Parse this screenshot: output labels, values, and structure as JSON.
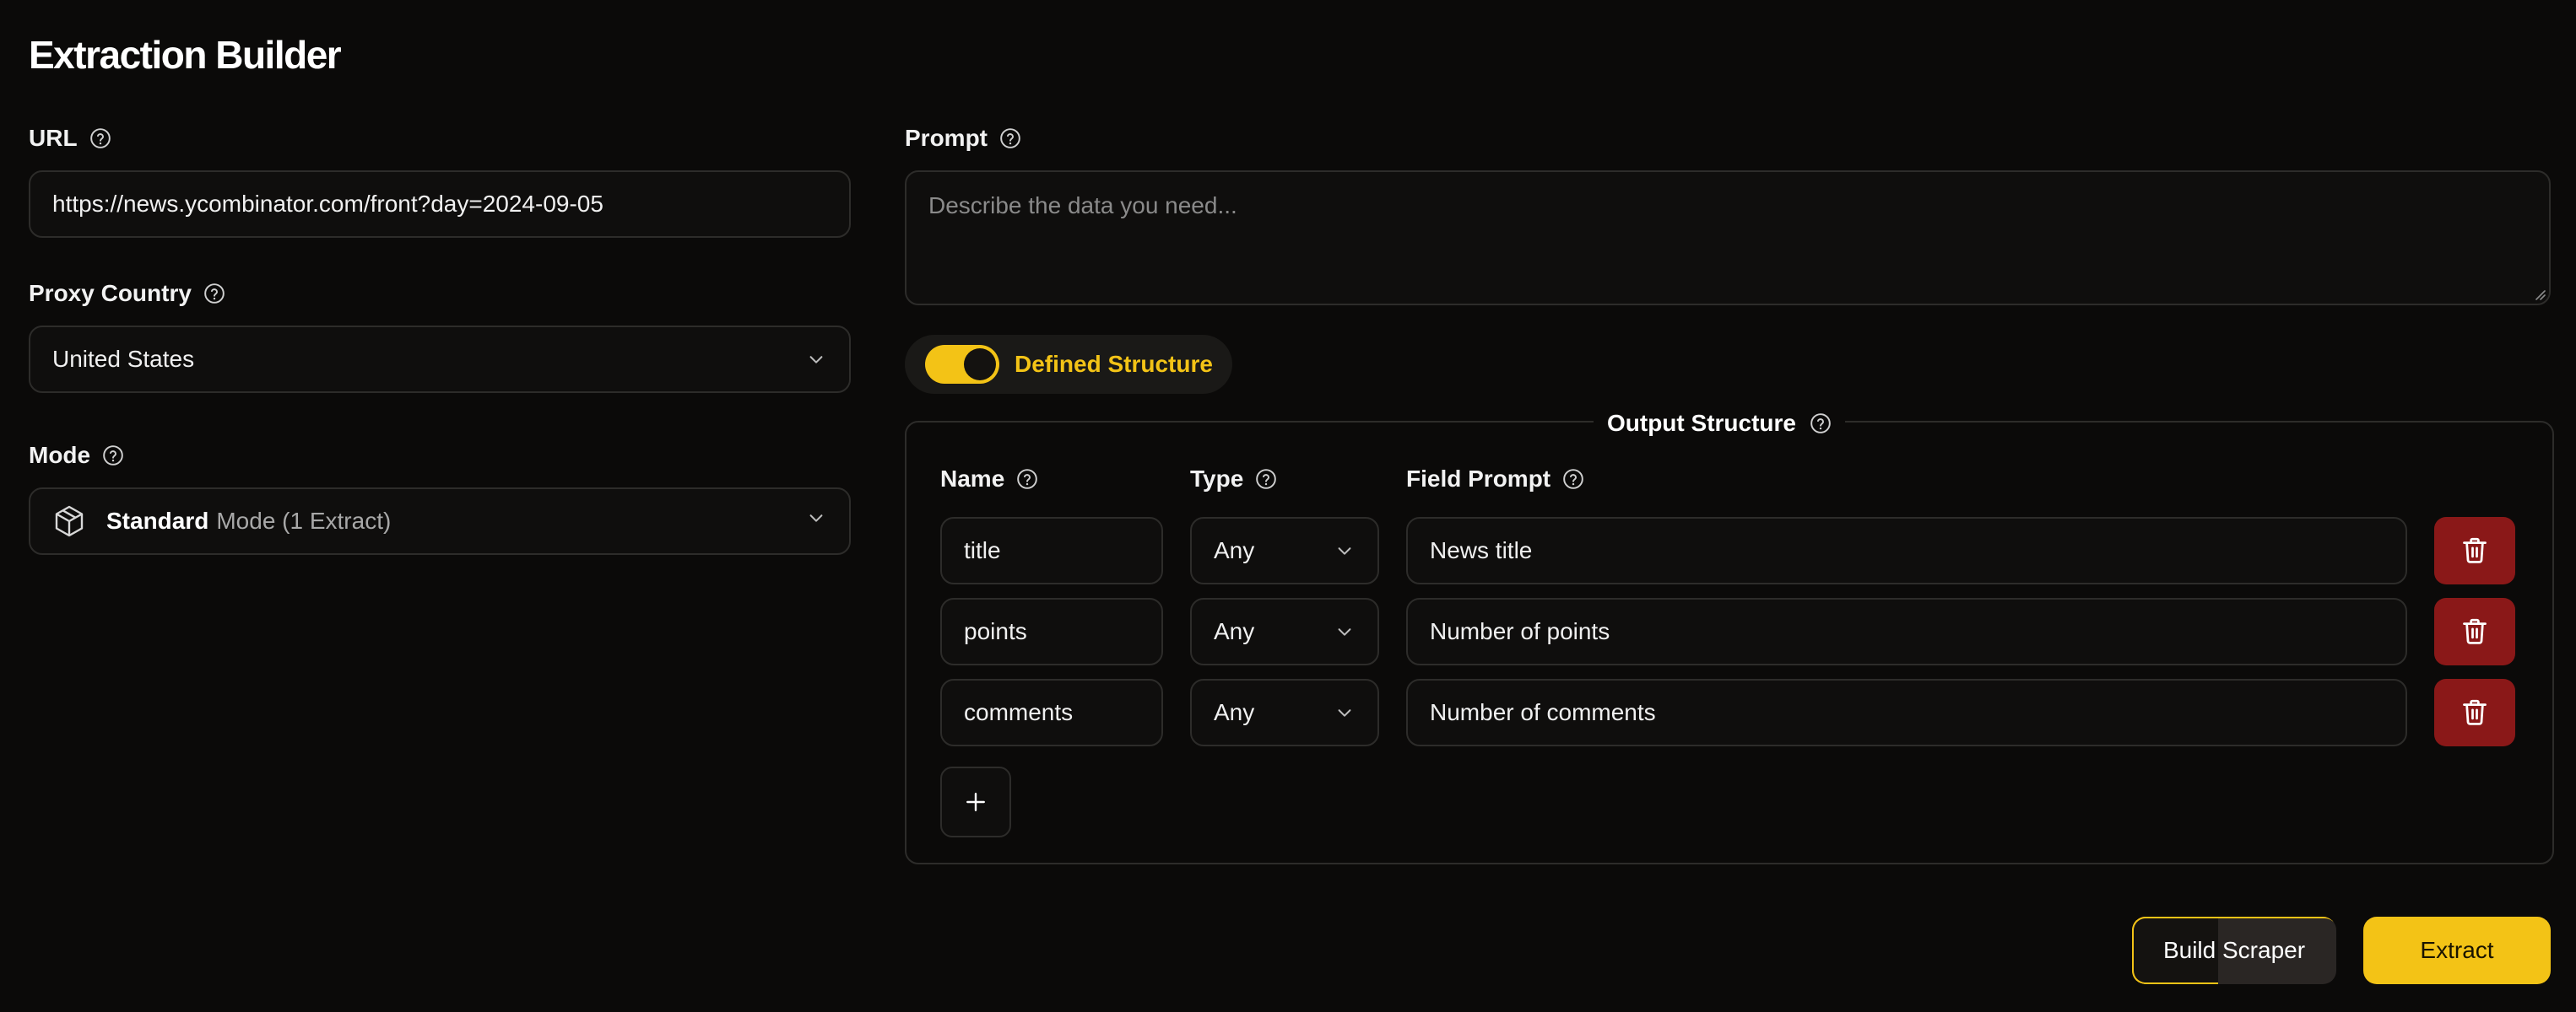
{
  "page": {
    "title": "Extraction Builder"
  },
  "url": {
    "label": "URL",
    "value": "https://news.ycombinator.com/front?day=2024-09-05"
  },
  "proxy": {
    "label": "Proxy Country",
    "selected": "United States"
  },
  "mode": {
    "label": "Mode",
    "selected_strong": "Standard",
    "selected_rest": "Mode (1 Extract)"
  },
  "prompt": {
    "label": "Prompt",
    "placeholder": "Describe the data you need..."
  },
  "structure_toggle": {
    "label": "Defined Structure",
    "on": true
  },
  "output": {
    "legend": "Output Structure",
    "headers": {
      "name": "Name",
      "type": "Type",
      "field_prompt": "Field Prompt"
    },
    "rows": [
      {
        "name": "title",
        "type": "Any",
        "prompt": "News title"
      },
      {
        "name": "points",
        "type": "Any",
        "prompt": "Number of points"
      },
      {
        "name": "comments",
        "type": "Any",
        "prompt": "Number of comments"
      }
    ]
  },
  "actions": {
    "build": "Build Scraper",
    "extract": "Extract"
  },
  "colors": {
    "accent": "#f3c316",
    "danger": "#8a1818",
    "background": "#0b0a09"
  }
}
